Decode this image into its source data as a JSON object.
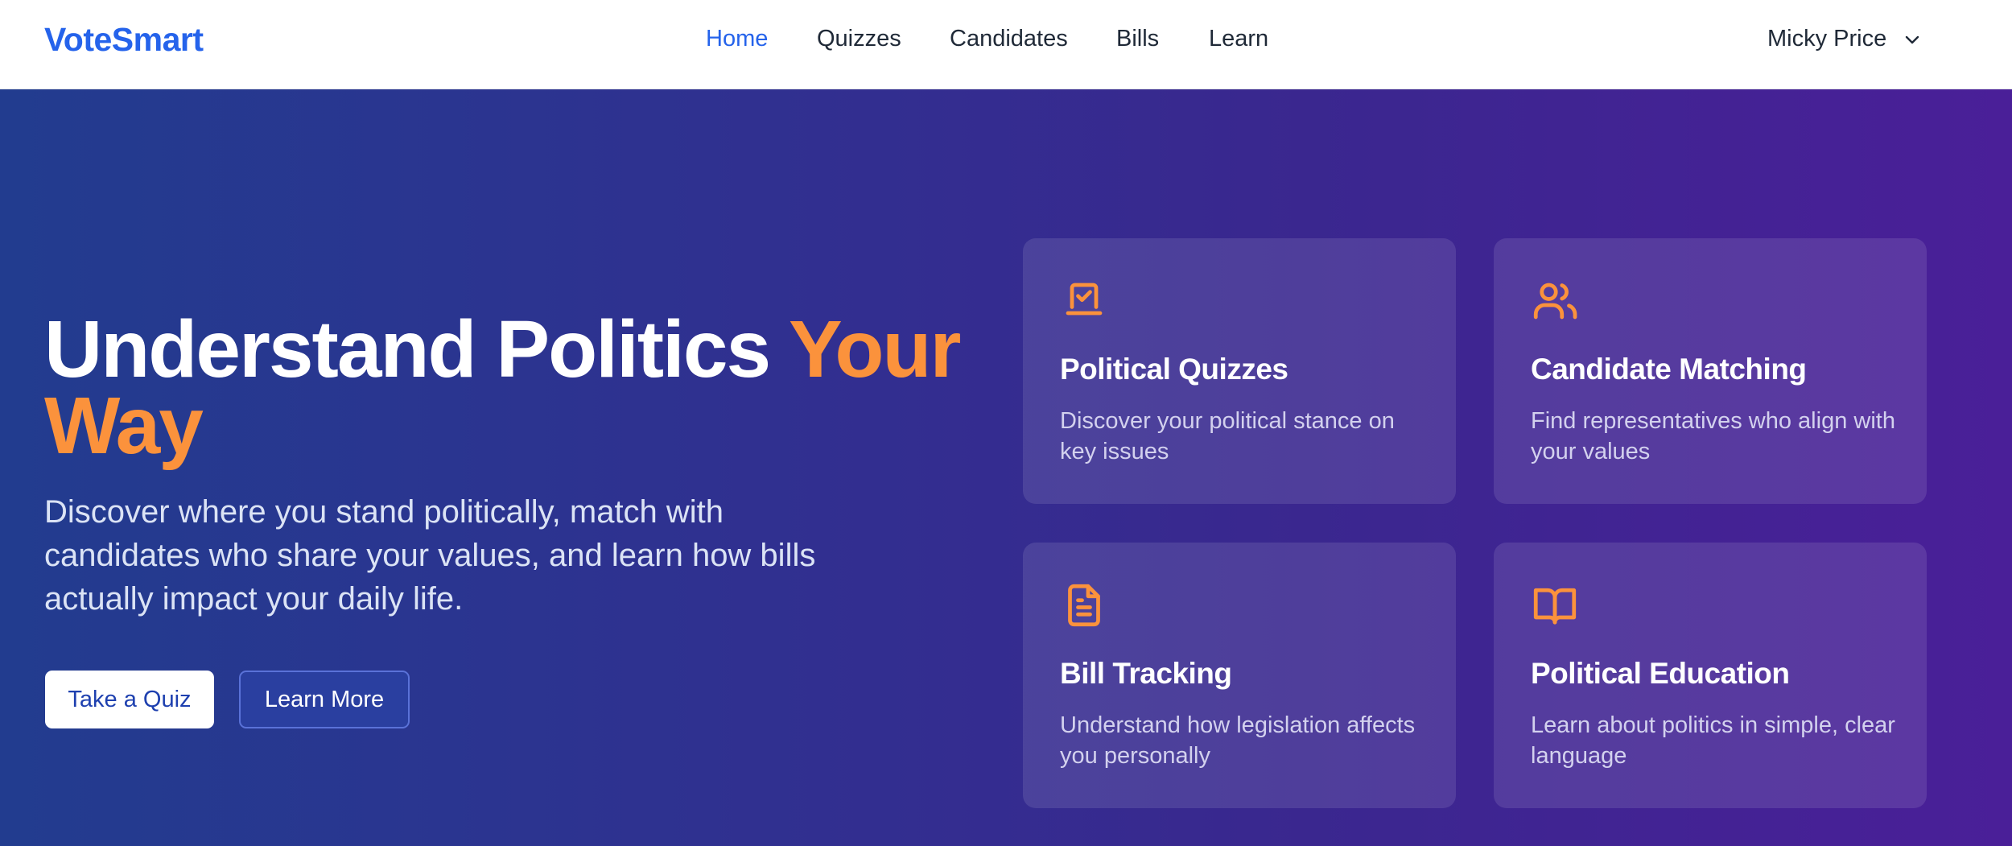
{
  "header": {
    "logo": "VoteSmart",
    "nav": [
      {
        "label": "Home",
        "active": true
      },
      {
        "label": "Quizzes",
        "active": false
      },
      {
        "label": "Candidates",
        "active": false
      },
      {
        "label": "Bills",
        "active": false
      },
      {
        "label": "Learn",
        "active": false
      }
    ],
    "user": {
      "name": "Micky Price",
      "icon": "chevron-down-icon"
    }
  },
  "hero": {
    "title_main": "Understand Politics",
    "title_accent": "Your Way",
    "subtitle": "Discover where you stand politically, match with candidates who share your values, and learn how bills actually impact your daily life.",
    "primary_button": "Take a Quiz",
    "secondary_button": "Learn More"
  },
  "features": [
    {
      "title": "Political Quizzes",
      "description": "Discover your political stance on key issues",
      "icon": "vote-box-icon"
    },
    {
      "title": "Candidate Matching",
      "description": "Find representatives who align with your values",
      "icon": "users-icon"
    },
    {
      "title": "Bill Tracking",
      "description": "Understand how legislation affects you personally",
      "icon": "document-icon"
    },
    {
      "title": "Political Education",
      "description": "Learn about politics in simple, clear language",
      "icon": "book-open-icon"
    }
  ],
  "colors": {
    "brand": "#2563eb",
    "accent": "#fb923c",
    "hero_start": "#223c8f",
    "hero_end": "#4a1f98"
  }
}
